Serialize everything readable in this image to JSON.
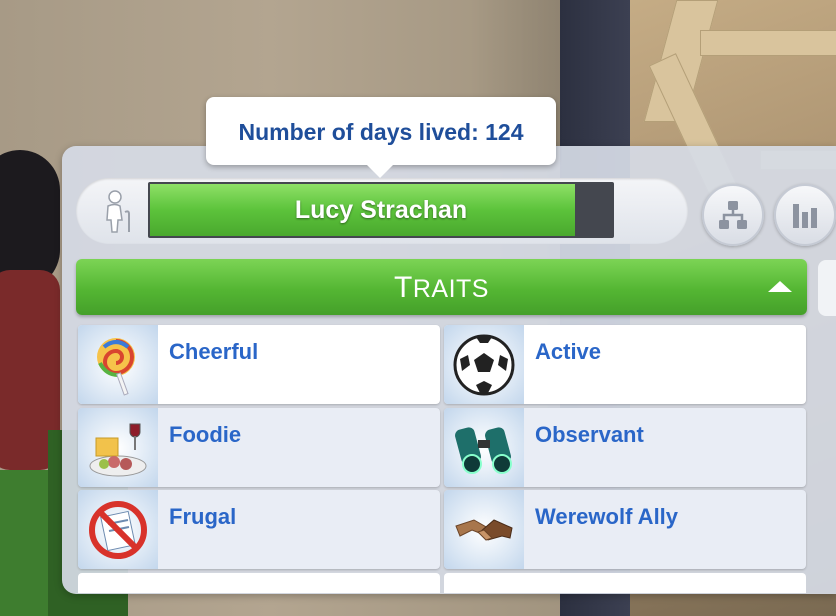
{
  "tooltip": {
    "text": "Number of days lived: 124"
  },
  "sim": {
    "name": "Lucy Strachan",
    "age_icon": "elder-cane-icon",
    "progress": 0.92
  },
  "buttons": {
    "family_tree": "family-tree-icon",
    "stats": "stats-bars-icon"
  },
  "traits": {
    "header_cap": "T",
    "header_rest": "RAITS",
    "items": [
      {
        "label": "Cheerful",
        "icon": "lollipop-icon"
      },
      {
        "label": "Active",
        "icon": "soccer-ball-icon"
      },
      {
        "label": "Foodie",
        "icon": "food-platter-icon"
      },
      {
        "label": "Observant",
        "icon": "binoculars-icon"
      },
      {
        "label": "Frugal",
        "icon": "no-money-icon"
      },
      {
        "label": "Werewolf Ally",
        "icon": "handshake-icon"
      }
    ]
  },
  "colors": {
    "accent_green": "#54b633",
    "trait_text": "#2a66c8",
    "tooltip_text": "#1f4e9a"
  }
}
